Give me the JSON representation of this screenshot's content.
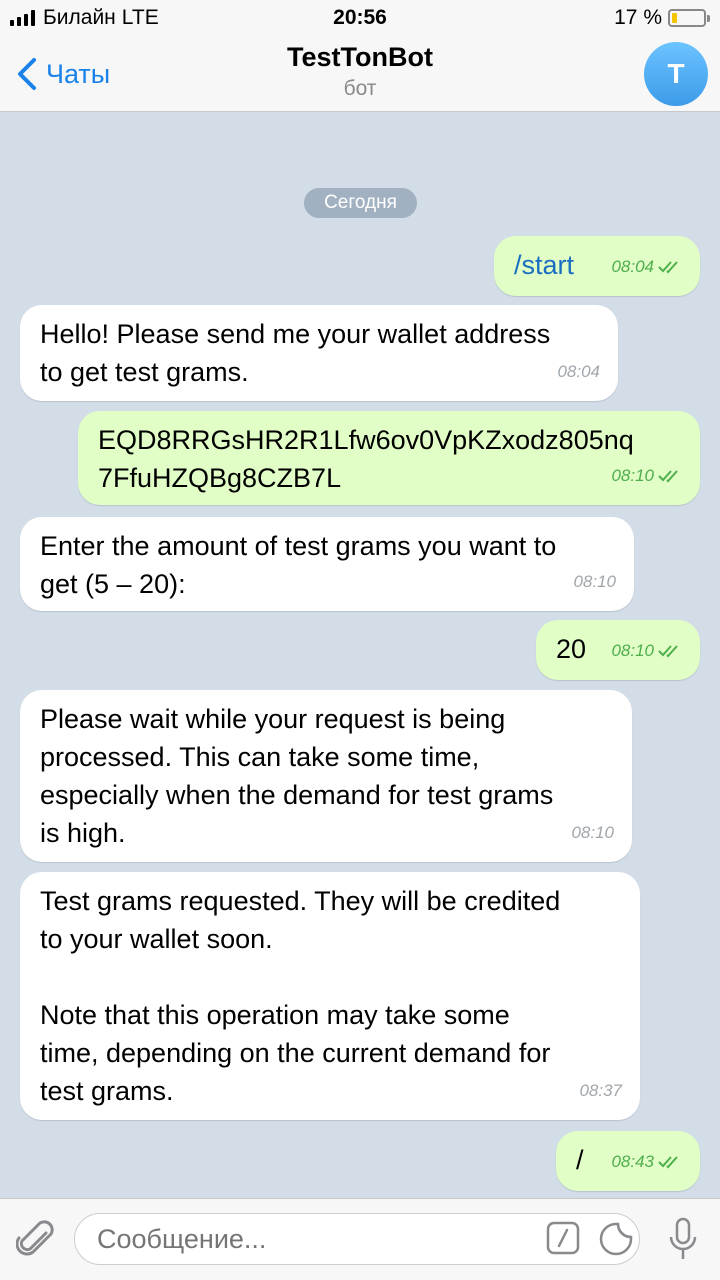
{
  "status_bar": {
    "carrier": "Билайн",
    "network": "LTE",
    "time": "20:56",
    "battery_percent_label": "17 %",
    "battery_level": 0.17
  },
  "nav": {
    "back_label": "Чаты",
    "title": "TestTonBot",
    "subtitle": "бот",
    "avatar_letter": "T"
  },
  "chat": {
    "date_label": "Сегодня",
    "messages": [
      {
        "direction": "out",
        "text": "/start",
        "time": "08:04"
      },
      {
        "direction": "in",
        "text": "Hello! Please send me your wallet address\nto get test grams.",
        "time": "08:04"
      },
      {
        "direction": "out",
        "text": "EQD8RRGsHR2R1Lfw6ov0VpKZxodz805nq\n7FfuHZQBg8CZB7L",
        "time": "08:10"
      },
      {
        "direction": "in",
        "text": "Enter the amount of test grams you want to\nget (5 – 20):",
        "time": "08:10"
      },
      {
        "direction": "out",
        "text": "20",
        "time": "08:10"
      },
      {
        "direction": "in",
        "text": "Please wait while your request is being\nprocessed. This can take some time,\nespecially when the demand for test grams\nis high.",
        "time": "08:10"
      },
      {
        "direction": "in",
        "text": "Test grams requested. They will be credited\nto your wallet soon.\n\nNote that this operation may take some\ntime, depending on the current demand for\ntest grams.",
        "time": "08:37"
      },
      {
        "direction": "out",
        "text": "/",
        "time": "08:43"
      }
    ]
  },
  "input": {
    "placeholder": "Сообщение..."
  },
  "colors": {
    "accent": "#1a82e8",
    "outgoing_bubble": "#e1fec6",
    "incoming_bubble": "#ffffff",
    "chat_background": "#d2dde8",
    "read_check": "#4fae4e"
  },
  "icons": [
    "signal-icon",
    "battery-icon",
    "back-chevron-icon",
    "double-check-icon",
    "attach-icon",
    "command-icon",
    "sticker-icon",
    "microphone-icon"
  ]
}
